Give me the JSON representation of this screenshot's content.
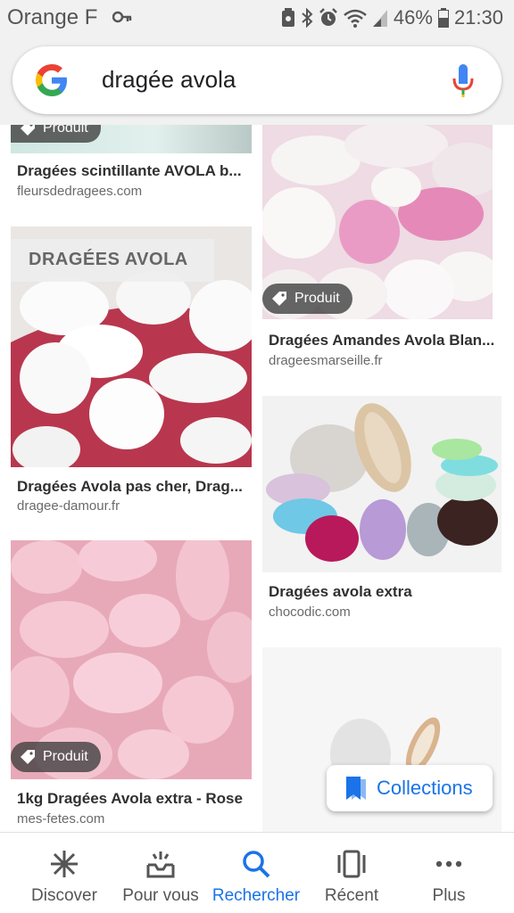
{
  "status_bar": {
    "carrier": "Orange F",
    "battery": "46%",
    "time": "21:30"
  },
  "search": {
    "query": "dragée avola"
  },
  "results": [
    {
      "title": "Dragées scintillante AVOLA b...",
      "source": "fleursdedragees.com",
      "badge": "Produit"
    },
    {
      "title": "Dragées Amandes Avola Blan...",
      "source": "drageesmarseille.fr",
      "badge": "Produit"
    },
    {
      "title": "Dragées Avola pas cher, Drag...",
      "source": "dragee-damour.fr",
      "image_text": "DRAGÉES AVOLA"
    },
    {
      "title": "Dragées avola extra",
      "source": "chocodic.com"
    },
    {
      "title": "1kg Dragées Avola extra - Rose",
      "source": "mes-fetes.com",
      "badge": "Produit"
    }
  ],
  "collections_label": "Collections",
  "bottom_nav": [
    {
      "label": "Discover",
      "icon": "asterisk-icon"
    },
    {
      "label": "Pour vous",
      "icon": "inbox-updates-icon"
    },
    {
      "label": "Rechercher",
      "icon": "search-icon",
      "active": true
    },
    {
      "label": "Récent",
      "icon": "recent-cards-icon"
    },
    {
      "label": "Plus",
      "icon": "more-dots-icon"
    }
  ],
  "colors": {
    "accent": "#1a73e8",
    "status_bar_bg": "#f1f1f1"
  }
}
